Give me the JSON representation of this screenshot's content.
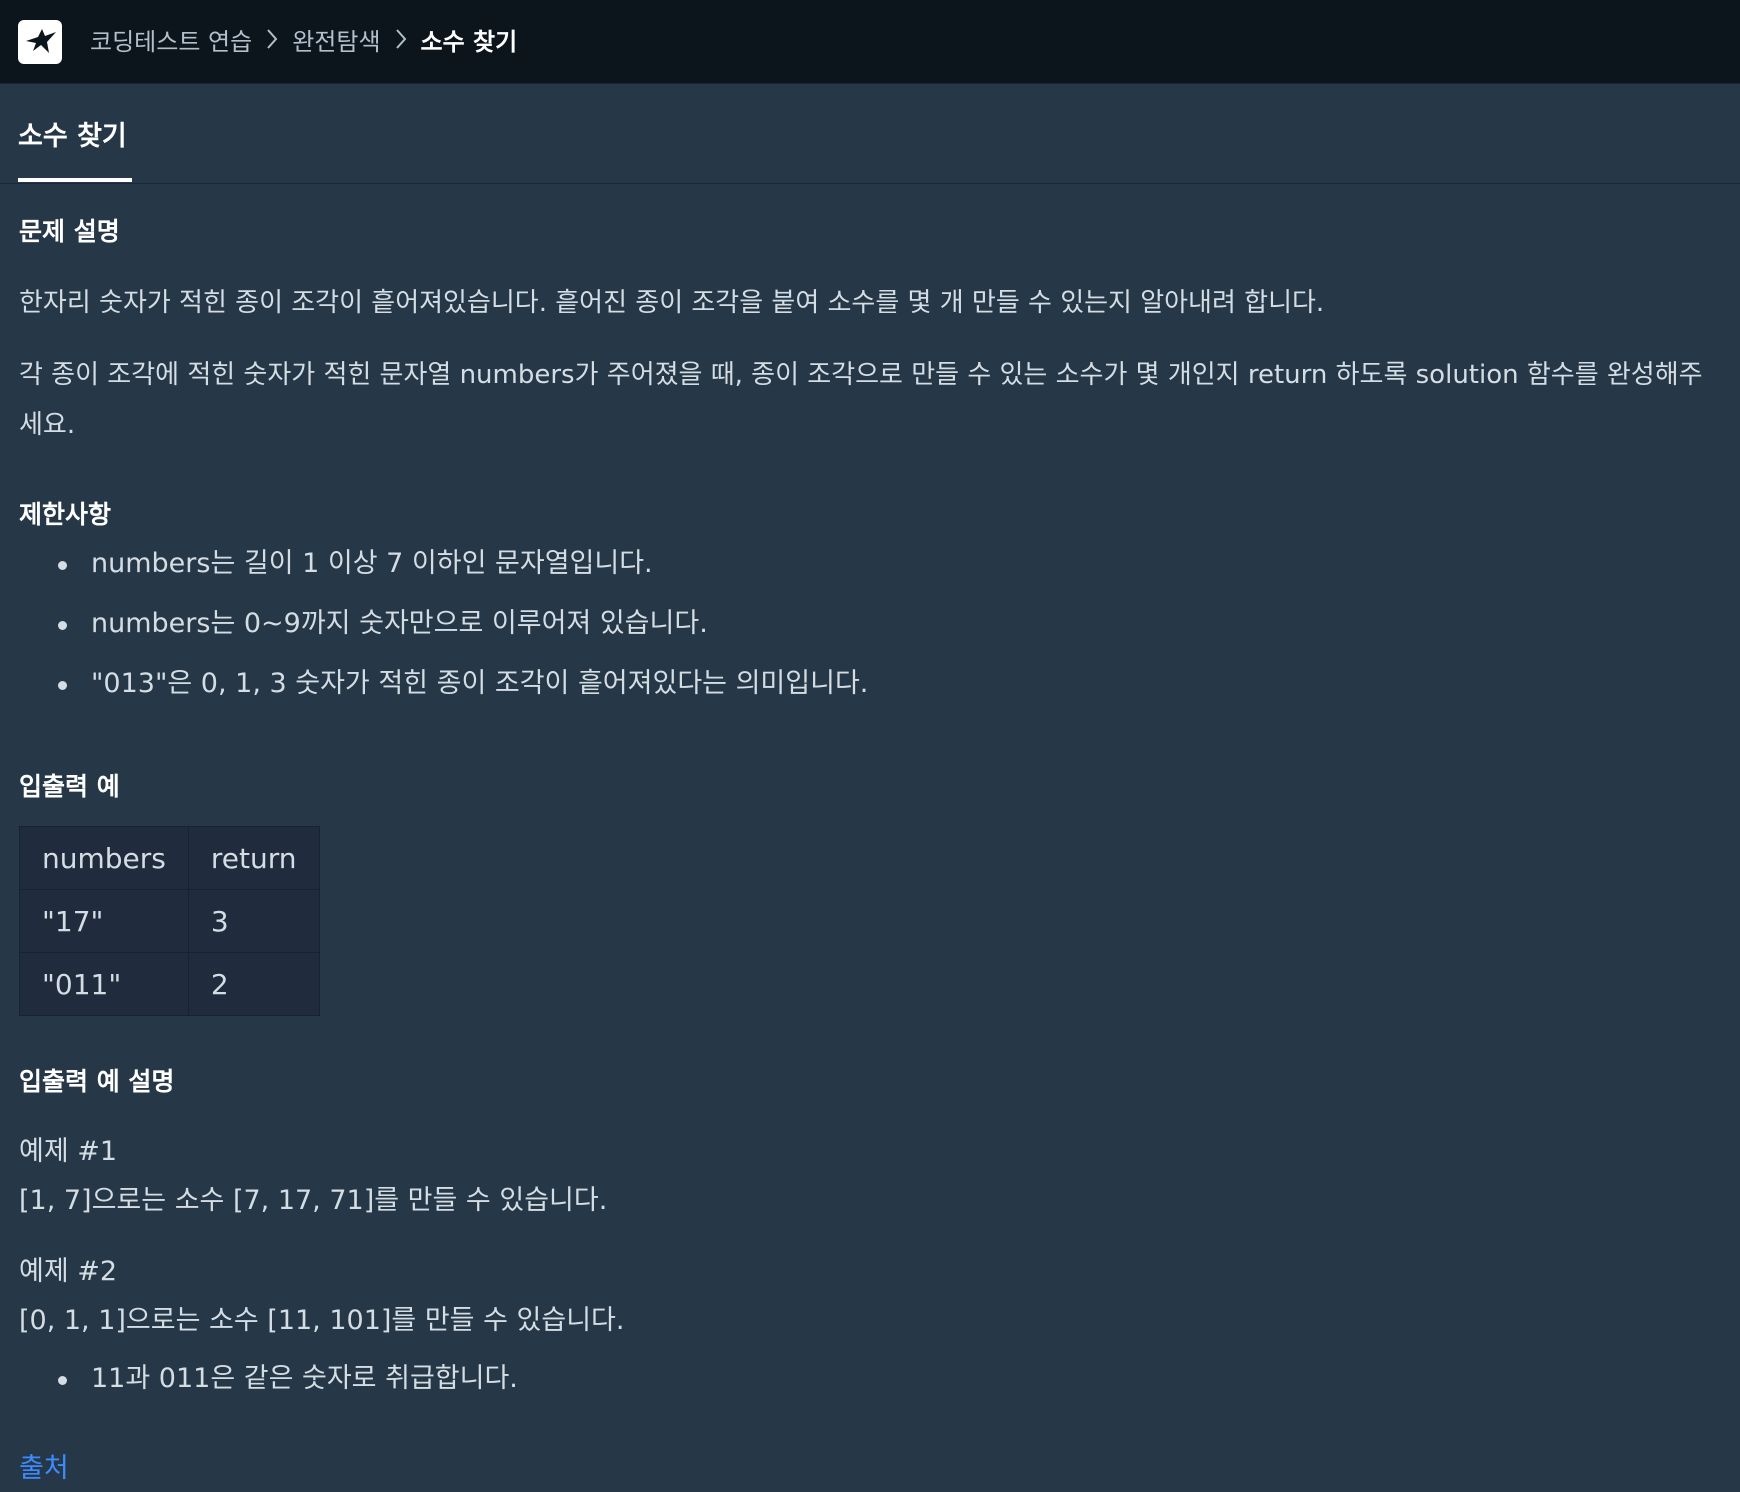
{
  "breadcrumb": {
    "items": [
      "코딩테스트 연습",
      "완전탐색",
      "소수 찾기"
    ]
  },
  "tab": {
    "label": "소수 찾기"
  },
  "problem": {
    "heading": "문제 설명",
    "paragraphs": [
      "한자리 숫자가 적힌 종이 조각이 흩어져있습니다. 흩어진 종이 조각을 붙여 소수를 몇 개 만들 수 있는지 알아내려 합니다.",
      "각 종이 조각에 적힌 숫자가 적힌 문자열 numbers가 주어졌을 때, 종이 조각으로 만들 수 있는 소수가 몇 개인지 return 하도록 solution 함수를 완성해주세요."
    ]
  },
  "constraints": {
    "heading": "제한사항",
    "items": [
      "numbers는 길이 1 이상 7 이하인 문자열입니다.",
      "numbers는 0~9까지 숫자만으로 이루어져 있습니다.",
      "\"013\"은 0, 1, 3 숫자가 적힌 종이 조각이 흩어져있다는 의미입니다."
    ]
  },
  "io_example": {
    "heading": "입출력 예",
    "columns": [
      "numbers",
      "return"
    ],
    "rows": [
      [
        "\"17\"",
        "3"
      ],
      [
        "\"011\"",
        "2"
      ]
    ]
  },
  "io_explanation": {
    "heading": "입출력 예 설명",
    "examples": [
      {
        "label": "예제 #1",
        "text": "[1, 7]으로는 소수 [7, 17, 71]를 만들 수 있습니다."
      },
      {
        "label": "예제 #2",
        "text": "[0, 1, 1]으로는 소수 [11, 101]를 만들 수 있습니다."
      }
    ],
    "notes": [
      "11과 011은 같은 숫자로 취급합니다."
    ]
  },
  "source": {
    "label": "출처"
  },
  "icons": {
    "logo": "programmers-logo-icon",
    "separator": "chevron-right-icon"
  },
  "colors": {
    "topbar_bg": "#0c151c",
    "page_bg": "#263747",
    "link": "#3e8bff",
    "table_bg": "#202b3d"
  }
}
